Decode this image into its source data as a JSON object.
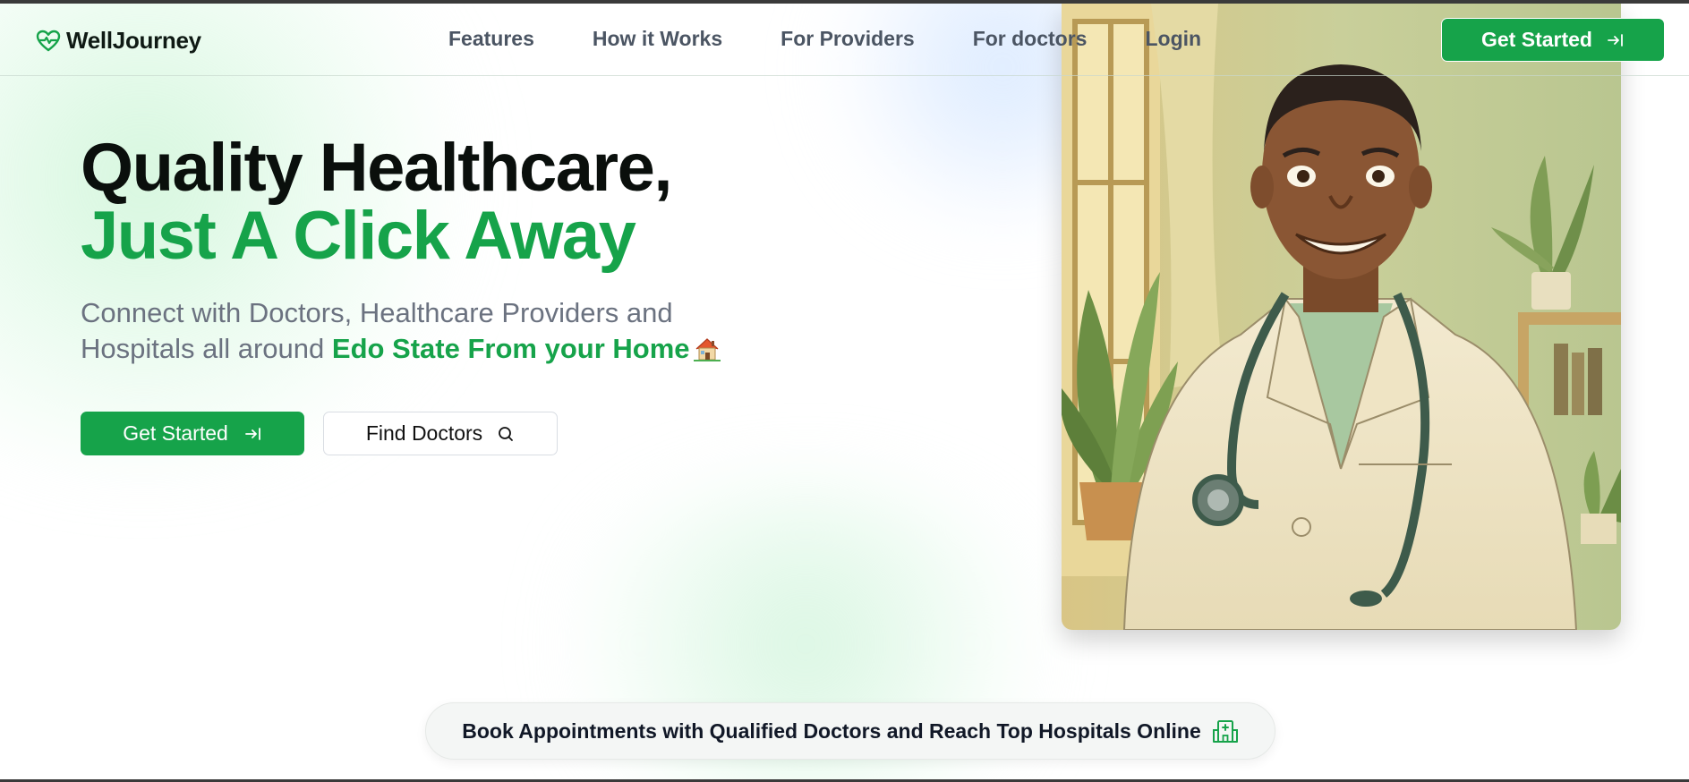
{
  "brand": {
    "name": "WellJourney",
    "logo_icon": "heart-pulse-icon",
    "accent": "#16a34a"
  },
  "nav": {
    "links": [
      "Features",
      "How it Works",
      "For Providers",
      "For doctors",
      "Login"
    ],
    "cta_label": "Get Started",
    "cta_icon": "arrow-right-to-line-icon"
  },
  "hero": {
    "title_line1": "Quality Healthcare,",
    "title_line2": "Just A Click Away",
    "subtitle_plain": "Connect with Doctors, Healthcare Providers and Hospitals all around",
    "subtitle_highlight": "Edo State From your Home",
    "subtitle_emoji_icon": "house-icon",
    "primary_button": "Get Started",
    "secondary_button": "Find Doctors",
    "secondary_icon": "search-icon",
    "image_subject": "doctor-illustration"
  },
  "banner": {
    "text": "Book Appointments with Qualified Doctors and Reach Top Hospitals Online",
    "icon": "hospital-icon"
  }
}
